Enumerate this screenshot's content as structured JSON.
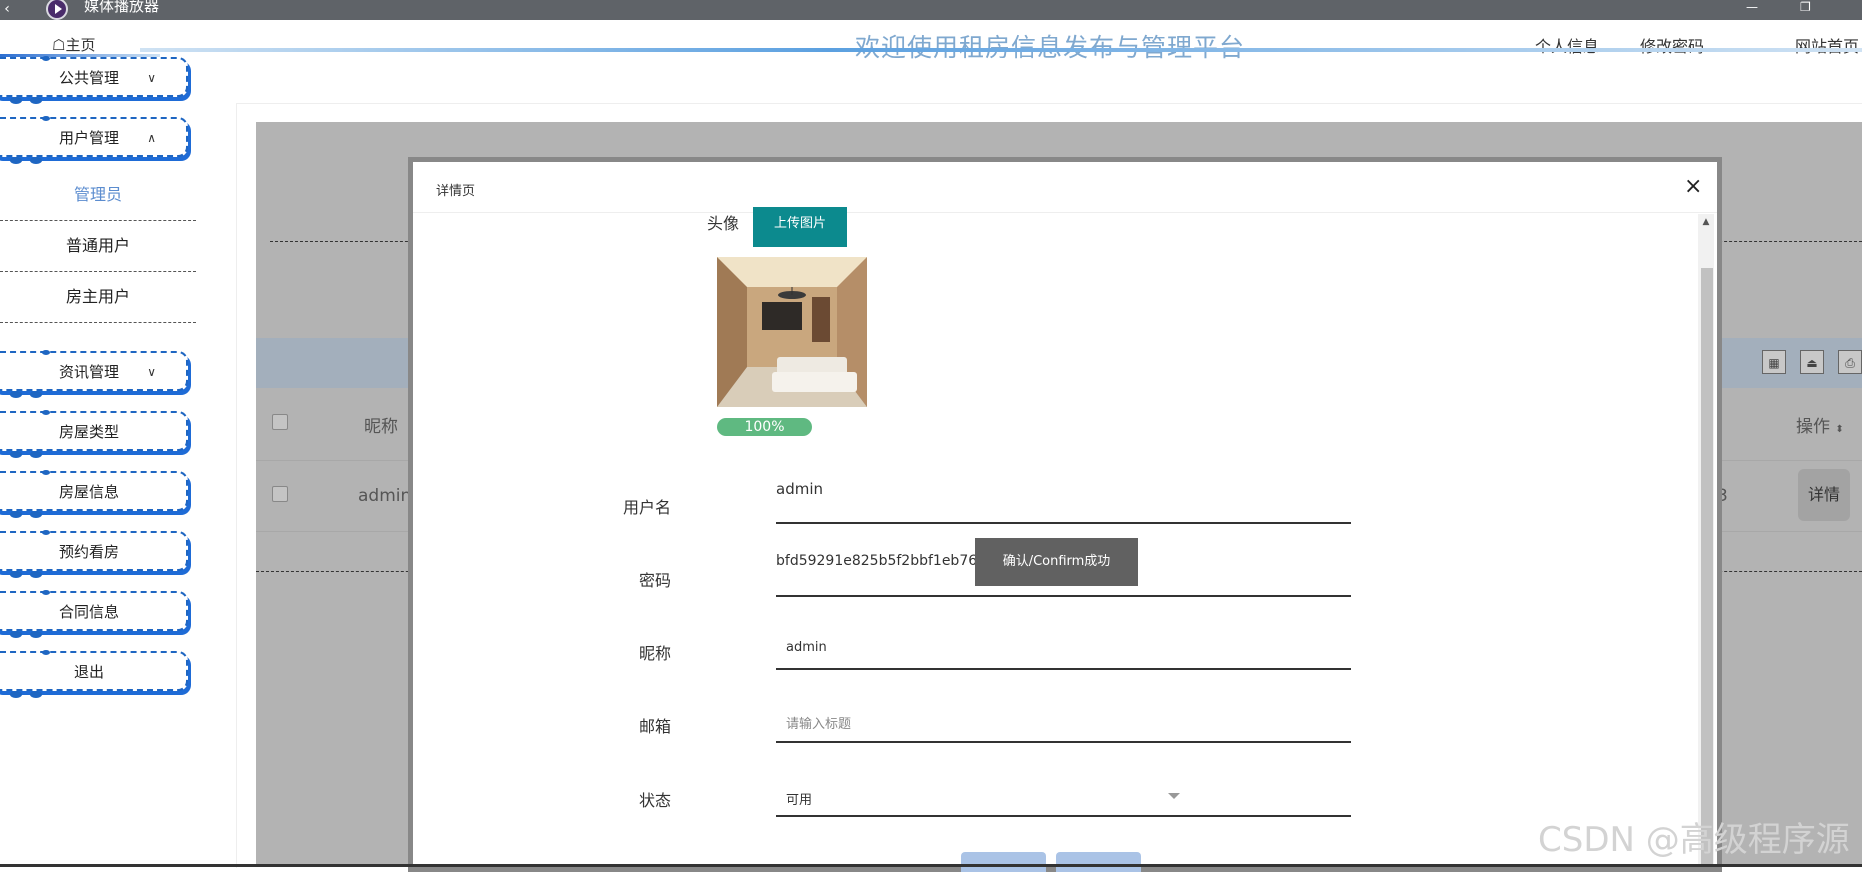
{
  "media_player": {
    "title": "媒体播放器",
    "back_glyph": "‹",
    "minimize_glyph": "—",
    "restore_glyph": "❐"
  },
  "header": {
    "home_label": "主页",
    "site_title": "欢迎使用租房信息发布与管理平台",
    "links": [
      "个人信息",
      "修改密码",
      "网站首页"
    ]
  },
  "sidebar": {
    "public_mgmt": "公共管理",
    "user_mgmt": "用户管理",
    "user_sub": [
      "管理员",
      "普通用户",
      "房主用户"
    ],
    "news_mgmt": "资讯管理",
    "items": [
      "房屋类型",
      "房屋信息",
      "预约看房",
      "合同信息",
      "退出"
    ],
    "chevron_down": "∨",
    "chevron_up": "∧"
  },
  "table": {
    "col_nickname": "昵称",
    "col_action": "操作",
    "row_nickname": "admin",
    "row_partial": "3",
    "detail_label": "详情"
  },
  "dialog": {
    "title": "详情页",
    "close_glyph": "×",
    "avatar_label": "头像",
    "upload_label": "上传图片",
    "progress_text": "100%",
    "progress_value": 1.0,
    "username_label": "用户名",
    "username_value": "admin",
    "password_label": "密码",
    "password_value": "bfd59291e825b5f2bbf1eb76569f8fe7",
    "nickname_label": "昵称",
    "nickname_value": "admin",
    "email_label": "邮箱",
    "email_placeholder": "请输入标题",
    "status_label": "状态",
    "status_value": "可用"
  },
  "toast": "确认/Confirm成功",
  "watermark": "CSDN @高级程序源"
}
